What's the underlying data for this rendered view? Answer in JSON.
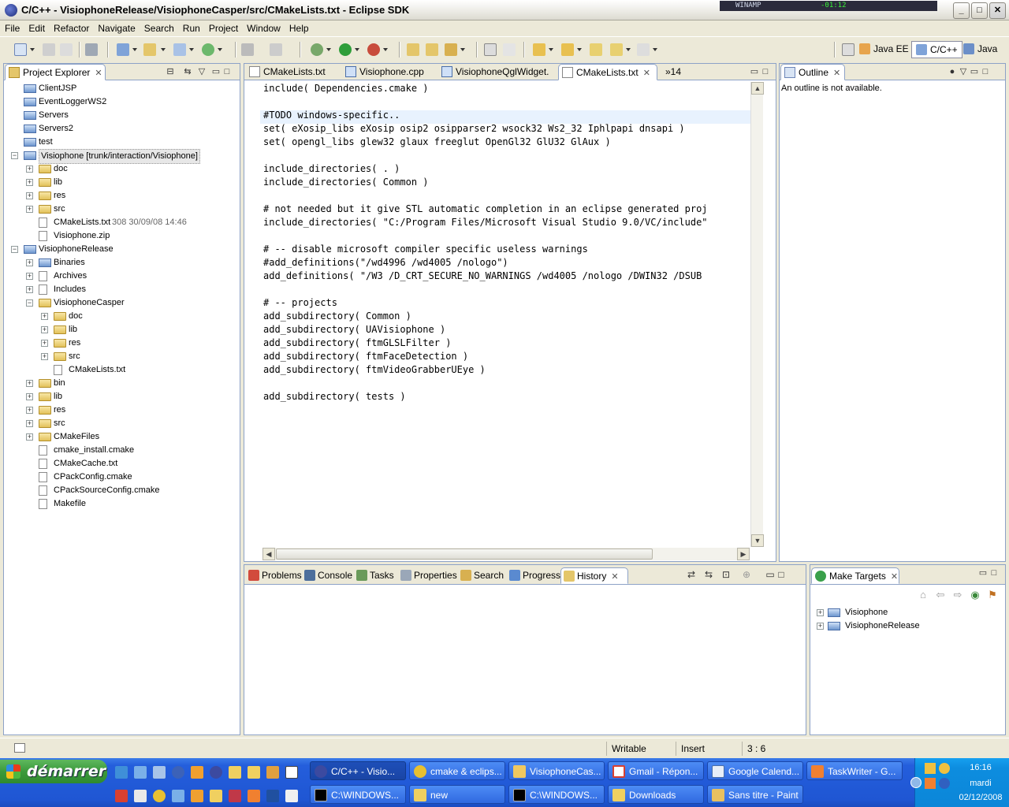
{
  "window": {
    "title": "C/C++ - VisiophoneRelease/VisiophoneCasper/src/CMakeLists.txt - Eclipse SDK",
    "winamp_label": "WINAMP",
    "winamp_time": "-01:12",
    "minimize": "_",
    "maximize": "□",
    "close": "✕"
  },
  "menu": [
    "File",
    "Edit",
    "Refactor",
    "Navigate",
    "Search",
    "Run",
    "Project",
    "Window",
    "Help"
  ],
  "perspectives": [
    {
      "label": "Java EE",
      "selected": false
    },
    {
      "label": "C/C++",
      "selected": true
    },
    {
      "label": "Java",
      "selected": false
    }
  ],
  "project_explorer": {
    "tab_label": "Project Explorer",
    "items": [
      {
        "label": "ClientJSP",
        "depth": 0,
        "expander": "",
        "icon": "project-icon"
      },
      {
        "label": "EventLoggerWS2",
        "depth": 0,
        "expander": "",
        "icon": "project-icon"
      },
      {
        "label": "Servers",
        "depth": 0,
        "expander": "",
        "icon": "project-icon"
      },
      {
        "label": "Servers2",
        "depth": 0,
        "expander": "",
        "icon": "project-icon"
      },
      {
        "label": "test",
        "depth": 0,
        "expander": "",
        "icon": "project-icon"
      },
      {
        "label": "Visiophone [trunk/interaction/Visiophone]",
        "depth": 0,
        "expander": "−",
        "icon": "svn-project-icon",
        "selected": true
      },
      {
        "label": "doc",
        "depth": 1,
        "expander": "+",
        "icon": "folder-icon"
      },
      {
        "label": "lib",
        "depth": 1,
        "expander": "+",
        "icon": "folder-icon"
      },
      {
        "label": "res",
        "depth": 1,
        "expander": "+",
        "icon": "folder-icon"
      },
      {
        "label": "src",
        "depth": 1,
        "expander": "+",
        "icon": "folder-icon"
      },
      {
        "label": "CMakeLists.txt",
        "decoration": "308  30/09/08 14:46",
        "depth": 1,
        "expander": "",
        "icon": "text-file-icon"
      },
      {
        "label": "Visiophone.zip",
        "depth": 1,
        "expander": "",
        "icon": "zip-file-icon"
      },
      {
        "label": "VisiophoneRelease",
        "depth": 0,
        "expander": "−",
        "icon": "cpp-project-icon"
      },
      {
        "label": "Binaries",
        "depth": 1,
        "expander": "+",
        "icon": "binaries-icon"
      },
      {
        "label": "Archives",
        "depth": 1,
        "expander": "+",
        "icon": "archives-icon"
      },
      {
        "label": "Includes",
        "depth": 1,
        "expander": "+",
        "icon": "includes-icon"
      },
      {
        "label": "VisiophoneCasper",
        "depth": 1,
        "expander": "−",
        "icon": "folder-icon"
      },
      {
        "label": "doc",
        "depth": 2,
        "expander": "+",
        "icon": "folder-icon"
      },
      {
        "label": "lib",
        "depth": 2,
        "expander": "+",
        "icon": "folder-icon"
      },
      {
        "label": "res",
        "depth": 2,
        "expander": "+",
        "icon": "folder-icon"
      },
      {
        "label": "src",
        "depth": 2,
        "expander": "+",
        "icon": "folder-icon"
      },
      {
        "label": "CMakeLists.txt",
        "depth": 2,
        "expander": "",
        "icon": "text-file-icon"
      },
      {
        "label": "bin",
        "depth": 1,
        "expander": "+",
        "icon": "folder-icon"
      },
      {
        "label": "lib",
        "depth": 1,
        "expander": "+",
        "icon": "folder-icon"
      },
      {
        "label": "res",
        "depth": 1,
        "expander": "+",
        "icon": "folder-icon"
      },
      {
        "label": "src",
        "depth": 1,
        "expander": "+",
        "icon": "folder-icon"
      },
      {
        "label": "CMakeFiles",
        "depth": 1,
        "expander": "+",
        "icon": "folder-icon"
      },
      {
        "label": "cmake_install.cmake",
        "depth": 1,
        "expander": "",
        "icon": "file-icon"
      },
      {
        "label": "CMakeCache.txt",
        "depth": 1,
        "expander": "",
        "icon": "text-file-icon"
      },
      {
        "label": "CPackConfig.cmake",
        "depth": 1,
        "expander": "",
        "icon": "file-icon"
      },
      {
        "label": "CPackSourceConfig.cmake",
        "depth": 1,
        "expander": "",
        "icon": "file-icon"
      },
      {
        "label": "Makefile",
        "depth": 1,
        "expander": "",
        "icon": "makefile-icon"
      }
    ]
  },
  "editor": {
    "tabs": [
      {
        "label": "CMakeLists.txt",
        "active": false
      },
      {
        "label": "Visiophone.cpp",
        "active": false
      },
      {
        "label": "VisiophoneQglWidget.",
        "active": false
      },
      {
        "label": "CMakeLists.txt",
        "active": true
      }
    ],
    "overflow_label": "»14",
    "current_line": 3,
    "lines": [
      "include( Dependencies.cmake )",
      "",
      "#TODO windows-specific..",
      "set( eXosip_libs eXosip osip2 osipparser2 wsock32 Ws2_32 Iphlpapi dnsapi )",
      "set( opengl_libs glew32 glaux freeglut OpenGl32 GlU32 GlAux )",
      "",
      "include_directories( . )",
      "include_directories( Common )",
      "",
      "# not needed but it give STL automatic completion in an eclipse generated proj",
      "include_directories( \"C:/Program Files/Microsoft Visual Studio 9.0/VC/include\"",
      "",
      "# -- disable microsoft compiler specific useless warnings",
      "#add_definitions(\"/wd4996 /wd4005 /nologo\")",
      "add_definitions( \"/W3 /D_CRT_SECURE_NO_WARNINGS /wd4005 /nologo /DWIN32 /DSUB",
      "",
      "# -- projects",
      "add_subdirectory( Common )",
      "add_subdirectory( UAVisiophone )",
      "add_subdirectory( ftmGLSLFilter )",
      "add_subdirectory( ftmFaceDetection )",
      "add_subdirectory( ftmVideoGrabberUEye )",
      "",
      "add_subdirectory( tests )"
    ]
  },
  "outline": {
    "tab_label": "Outline",
    "message": "An outline is not available."
  },
  "bottom_panel": {
    "tabs": [
      {
        "label": "Problems",
        "active": false
      },
      {
        "label": "Console",
        "active": false
      },
      {
        "label": "Tasks",
        "active": false
      },
      {
        "label": "Properties",
        "active": false
      },
      {
        "label": "Search",
        "active": false
      },
      {
        "label": "Progress",
        "active": false
      },
      {
        "label": "History",
        "active": true
      }
    ]
  },
  "make_targets": {
    "tab_label": "Make Targets",
    "items": [
      {
        "label": "Visiophone"
      },
      {
        "label": "VisiophoneRelease"
      }
    ]
  },
  "status": {
    "writable": "Writable",
    "insert_mode": "Insert",
    "position": "3 : 6"
  },
  "taskbar": {
    "start_label": "démarrer",
    "row1": [
      {
        "label": "C/C++ - Visio...",
        "active": true,
        "icon": "eclipse-icon"
      },
      {
        "label": "cmake & eclips...",
        "active": false,
        "icon": "chrome-icon"
      },
      {
        "label": "VisiophoneCas...",
        "active": false,
        "icon": "app-icon"
      },
      {
        "label": "Gmail - Répon...",
        "active": false,
        "icon": "gmail-icon"
      },
      {
        "label": "Google Calend...",
        "active": false,
        "icon": "calendar-icon"
      },
      {
        "label": "TaskWriter - G...",
        "active": false,
        "icon": "taskwriter-icon"
      }
    ],
    "row2": [
      {
        "label": "C:\\WINDOWS...",
        "active": false,
        "icon": "cmd-icon"
      },
      {
        "label": "new",
        "active": false,
        "icon": "folder-icon"
      },
      {
        "label": "C:\\WINDOWS...",
        "active": false,
        "icon": "cmd-icon"
      },
      {
        "label": "Downloads",
        "active": false,
        "icon": "folder-icon"
      },
      {
        "label": "Sans titre - Paint",
        "active": false,
        "icon": "paint-icon"
      }
    ],
    "clock_time": "16:16",
    "clock_day": "mardi",
    "clock_date": "02/12/2008"
  }
}
